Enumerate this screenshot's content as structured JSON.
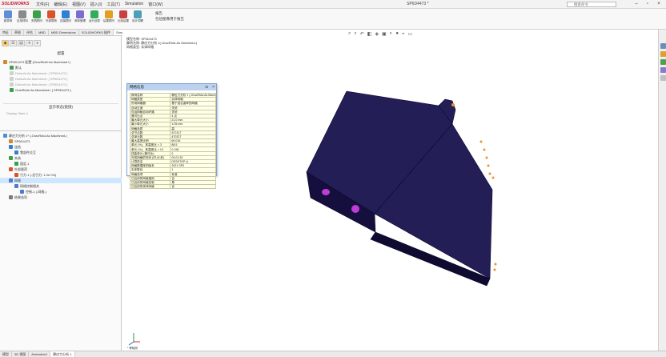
{
  "app": {
    "logo_text": "SOLIDWORKS",
    "window_title": "SP6D4473 *"
  },
  "menu": [
    "文件(F)",
    "编辑(E)",
    "视图(V)",
    "插入(I)",
    "工具(T)",
    "Simulation",
    "窗口(W)"
  ],
  "search": {
    "placeholder": "搜索命令"
  },
  "ribbon": {
    "buttons": [
      "新算例",
      "应用材料",
      "夹具顾问",
      "外部载荷",
      "连接顾问",
      "壳体管理",
      "运行此算例",
      "结果顾问",
      "比较结果",
      "设计洞察"
    ],
    "right_items": [
      "报告",
      "包括图像用于报告"
    ]
  },
  "tabs": [
    "特征",
    "草图",
    "评估",
    "MBD",
    "MBD Dimensions",
    "SOLIDWORKS 插件",
    "Simulation",
    "MBD",
    "分析准备"
  ],
  "active_tab_index": 6,
  "left_panel": {
    "configs_title": "配置",
    "root_label": "SP6D4473 配置 (GravRidd+As Machined+)",
    "configs": [
      {
        "label": "默认",
        "dim": false
      },
      {
        "label": "Default<As Machined> [ SP6D4473 ]",
        "dim": true
      },
      {
        "label": "Default<As Machined> [ SP6D4473 ]",
        "dim": true
      },
      {
        "label": "Default<As Machined> [ SP6D4473 ]",
        "dim": true
      },
      {
        "label": "GravRidd<As Machined> [ SP6D4473 ]",
        "dim": false
      }
    ],
    "display_states_title": "显示状态(链接)",
    "display_state_item": "Display State-1",
    "study_root": "静应力分析 1* (-GravRidd-As Machined-)",
    "study_items": [
      {
        "label": "SP6D4473",
        "level": 1,
        "icon": "part"
      },
      {
        "label": "连结",
        "level": 1,
        "icon": "connection"
      },
      {
        "label": "零部件交互",
        "level": 2,
        "icon": "connection"
      },
      {
        "label": "夹具",
        "level": 1,
        "icon": "fixture"
      },
      {
        "label": "固定-1",
        "level": 2,
        "icon": "fixture"
      },
      {
        "label": "外部载荷",
        "level": 1,
        "icon": "load"
      },
      {
        "label": "引力-1 (:总引力: 1.0e+04)",
        "level": 2,
        "icon": "load"
      },
      {
        "label": "网格",
        "level": 1,
        "icon": "mesh",
        "selected": true
      },
      {
        "label": "网格控制相关",
        "level": 2,
        "icon": "mesh"
      },
      {
        "label": "控制-1 (-网格-)",
        "level": 3,
        "icon": "mesh"
      },
      {
        "label": "结果选项",
        "level": 1,
        "icon": "result"
      }
    ]
  },
  "viewport": {
    "study_info_lines": [
      "模型名称: SP6D4473",
      "算例名称: 静应力分析 1(-GravRidd-As Machined-)",
      "网格类型: 实体网格"
    ],
    "units_label": "* 等轴测"
  },
  "mesh_dialog": {
    "title": "网格信息",
    "rows": [
      [
        "算例名称",
        "静应力分析 1 (-GravRidd-As Machi"
      ],
      [
        "网格类型",
        "实体网格"
      ],
      [
        "所用网格器",
        "基于混合曲率的网格"
      ],
      [
        "自动过渡",
        "关闭"
      ],
      [
        "包括网格自动环路",
        "关闭"
      ],
      [
        "雅可比点",
        "4 点"
      ],
      [
        "最大单元大小",
        "21.0 mm"
      ],
      [
        "最小单元大小",
        "1.05 mm"
      ],
      [
        "网格品质",
        "高"
      ],
      [
        "总节点数",
        "917417"
      ],
      [
        "总单元数",
        "470327"
      ],
      [
        "最大高宽比例",
        "69.016"
      ],
      [
        "单元 (%)，其高宽比 < 3",
        "88.5"
      ],
      [
        "单元 (%)，其高宽比 > 10",
        "0.196"
      ],
      [
        "扭曲单元 (雅可比)",
        "0"
      ],
      [
        "完成网格的时间 (时;分;秒)",
        "00:01:30"
      ],
      [
        "计算机名",
        "DESKTOP-A"
      ],
      [
        "网格数据库的版本",
        "2021 SP0"
      ],
      [
        "实体数目",
        "1"
      ],
      [
        "网格选项",
        "标准"
      ],
      [
        "已启用的网格重用",
        "否"
      ],
      [
        "已启用的网格控制",
        "是"
      ],
      [
        "已启用的壳体网格",
        "否"
      ]
    ]
  },
  "bottom_tabs": [
    "模型",
    "3D 视图",
    "Animation1",
    "静应力分析 1"
  ],
  "active_bottom_index": 3,
  "colors": {
    "mesh_fill": "#1a1446",
    "mesh_line": "#3a3480",
    "highlight": "#c03cd6",
    "load_arrow": "#e8932e"
  }
}
